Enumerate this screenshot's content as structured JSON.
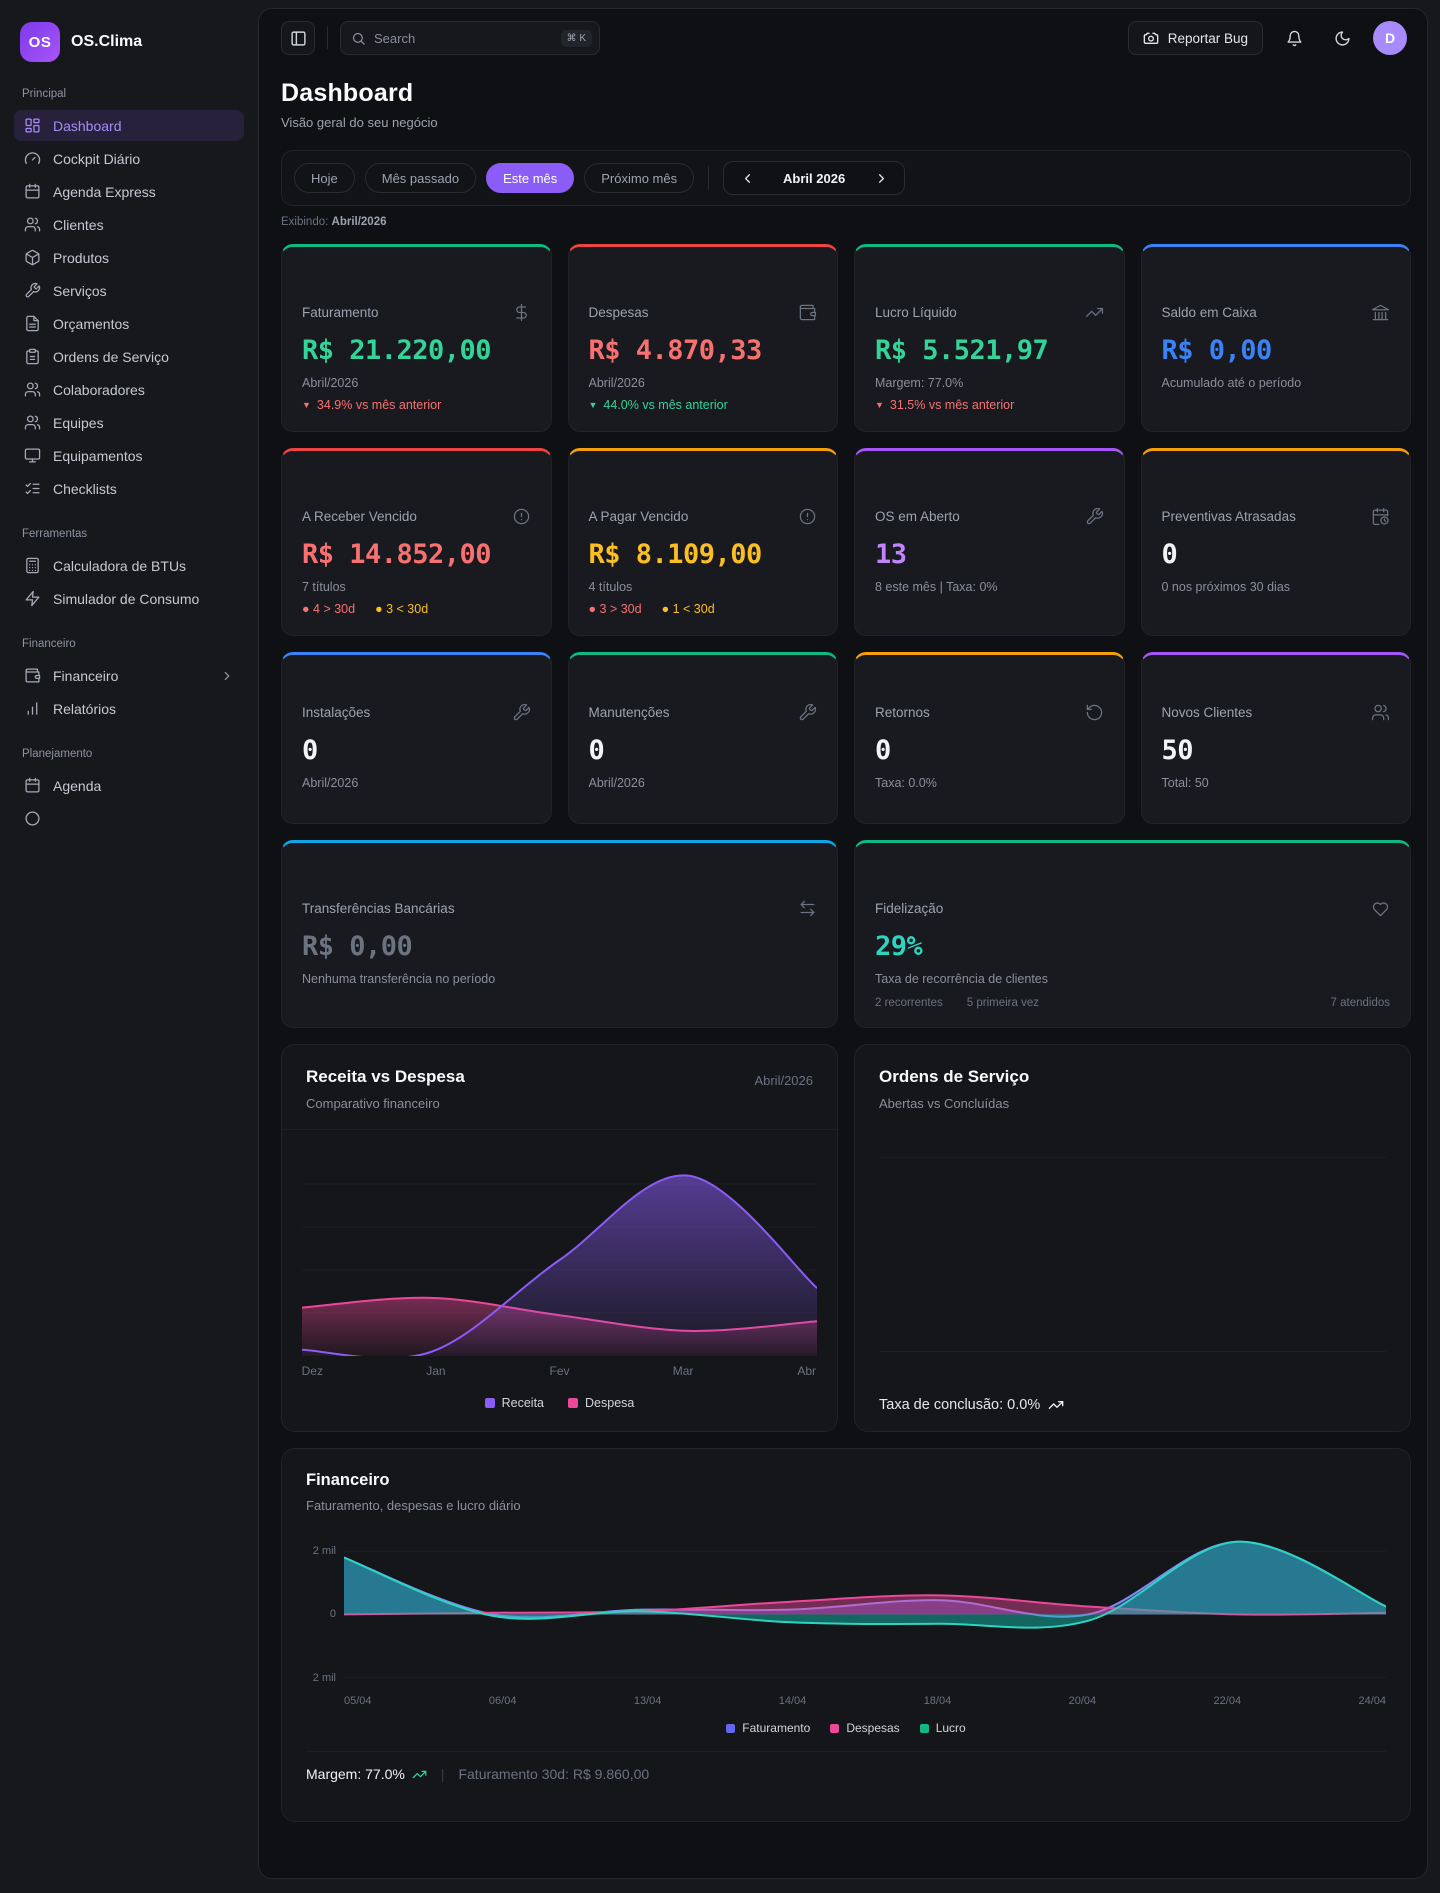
{
  "brand": {
    "logo_text": "OS",
    "name": "OS.Clima"
  },
  "topbar": {
    "search_placeholder": "Search",
    "search_shortcut": "⌘ K",
    "report_bug_label": "Reportar Bug",
    "avatar_initial": "D"
  },
  "header": {
    "title": "Dashboard",
    "subtitle": "Visão geral do seu negócio",
    "filters": [
      {
        "label": "Hoje",
        "active": false
      },
      {
        "label": "Mês passado",
        "active": false
      },
      {
        "label": "Este mês",
        "active": true
      },
      {
        "label": "Próximo mês",
        "active": false
      }
    ],
    "month_nav_label": "Abril 2026",
    "showing_label": "Exibindo:",
    "showing_value": "Abril/2026"
  },
  "sidebar": {
    "sections": [
      {
        "label": "Principal",
        "items": [
          {
            "label": "Dashboard",
            "icon": "layout-dashboard-icon",
            "active": true
          },
          {
            "label": "Cockpit Diário",
            "icon": "gauge-icon"
          },
          {
            "label": "Agenda Express",
            "icon": "calendar-icon"
          },
          {
            "label": "Clientes",
            "icon": "users-icon"
          },
          {
            "label": "Produtos",
            "icon": "package-icon"
          },
          {
            "label": "Serviços",
            "icon": "wrench-icon"
          },
          {
            "label": "Orçamentos",
            "icon": "file-text-icon"
          },
          {
            "label": "Ordens de Serviço",
            "icon": "clipboard-icon"
          },
          {
            "label": "Colaboradores",
            "icon": "users-icon"
          },
          {
            "label": "Equipes",
            "icon": "users-icon"
          },
          {
            "label": "Equipamentos",
            "icon": "monitor-icon"
          },
          {
            "label": "Checklists",
            "icon": "list-checks-icon"
          }
        ]
      },
      {
        "label": "Ferramentas",
        "items": [
          {
            "label": "Calculadora de BTUs",
            "icon": "calculator-icon"
          },
          {
            "label": "Simulador de Consumo",
            "icon": "zap-icon"
          }
        ]
      },
      {
        "label": "Financeiro",
        "items": [
          {
            "label": "Financeiro",
            "icon": "wallet-icon",
            "chevron": true
          },
          {
            "label": "Relatórios",
            "icon": "bar-chart-icon"
          }
        ]
      },
      {
        "label": "Planejamento",
        "items": [
          {
            "label": "Agenda",
            "icon": "calendar-icon"
          },
          {
            "label": "",
            "icon": "circle-icon",
            "clipped": true
          }
        ]
      }
    ]
  },
  "kpis": [
    {
      "title": "Faturamento",
      "icon": "dollar-icon",
      "accent": "#10b981",
      "value": "R$ 21.220,00",
      "value_color": "#34d399",
      "sub": "Abril/2026",
      "delta": {
        "text": "34.9% vs mês anterior",
        "color": "#f87171"
      }
    },
    {
      "title": "Despesas",
      "icon": "wallet-icon",
      "accent": "#ef4444",
      "value": "R$ 4.870,33",
      "value_color": "#f87171",
      "sub": "Abril/2026",
      "delta": {
        "text": "44.0% vs mês anterior",
        "color": "#34d399"
      }
    },
    {
      "title": "Lucro Líquido",
      "icon": "trending-up-icon",
      "accent": "#10b981",
      "value": "R$ 5.521,97",
      "value_color": "#34d399",
      "sub": "Margem: 77.0%",
      "delta": {
        "text": "31.5% vs mês anterior",
        "color": "#f87171"
      }
    },
    {
      "title": "Saldo em Caixa",
      "icon": "landmark-icon",
      "accent": "#3b82f6",
      "value": "R$ 0,00",
      "value_color": "#3b82f6",
      "sub": "Acumulado até o período"
    },
    {
      "title": "A Receber Vencido",
      "icon": "alert-circle-icon",
      "accent": "#ef4444",
      "value": "R$ 14.852,00",
      "value_color": "#f87171",
      "sub": "7 títulos",
      "dots": [
        {
          "text": "4 > 30d",
          "color": "#f87171"
        },
        {
          "text": "3 < 30d",
          "color": "#fbbf24"
        }
      ]
    },
    {
      "title": "A Pagar Vencido",
      "icon": "alert-circle-icon",
      "accent": "#f59e0b",
      "value": "R$ 8.109,00",
      "value_color": "#fbbf24",
      "sub": "4 títulos",
      "dots": [
        {
          "text": "3 > 30d",
          "color": "#f87171"
        },
        {
          "text": "1 < 30d",
          "color": "#fbbf24"
        }
      ]
    },
    {
      "title": "OS em Aberto",
      "icon": "wrench-icon",
      "accent": "#a855f7",
      "value": "13",
      "value_color": "#c084fc",
      "sub": "8 este mês | Taxa: 0%"
    },
    {
      "title": "Preventivas Atrasadas",
      "icon": "calendar-clock-icon",
      "accent": "#f59e0b",
      "value": "0",
      "value_color": "#f3f4f6",
      "sub": "0 nos próximos 30 dias"
    },
    {
      "title": "Instalações",
      "icon": "wrench-icon",
      "accent": "#3b82f6",
      "value": "0",
      "value_color": "#f3f4f6",
      "sub": "Abril/2026",
      "small": true
    },
    {
      "title": "Manutenções",
      "icon": "wrench-icon",
      "accent": "#10b981",
      "value": "0",
      "value_color": "#f3f4f6",
      "sub": "Abril/2026",
      "small": true
    },
    {
      "title": "Retornos",
      "icon": "rotate-ccw-icon",
      "accent": "#f59e0b",
      "value": "0",
      "value_color": "#f3f4f6",
      "sub": "Taxa: 0.0%",
      "small": true
    },
    {
      "title": "Novos Clientes",
      "icon": "users-icon",
      "accent": "#a855f7",
      "value": "50",
      "value_color": "#f3f4f6",
      "sub": "Total: 50",
      "small": true
    }
  ],
  "wide_kpis": [
    {
      "title": "Transferências Bancárias",
      "icon": "transfer-icon",
      "accent": "#0ea5e9",
      "value": "R$ 0,00",
      "value_color": "#6b7280",
      "sub": "Nenhuma transferência no período"
    },
    {
      "title": "Fidelização",
      "icon": "heart-icon",
      "accent": "#10b981",
      "value": "29%",
      "value_color": "#2dd4bf",
      "sub": "Taxa de recorrência de clientes",
      "foot": {
        "left": [
          "2 recorrentes",
          "5 primeira vez"
        ],
        "right": "7 atendidos"
      }
    }
  ],
  "chart_data": [
    {
      "id": "receita-vs-despesa",
      "type": "area",
      "title": "Receita vs Despesa",
      "subtitle": "Comparativo financeiro",
      "badge": "Abril/2026",
      "categories": [
        "Dez",
        "Jan",
        "Fev",
        "Mar",
        "Abr"
      ],
      "series": [
        {
          "name": "Receita",
          "color": "#8b5cf6",
          "values": [
            400,
            0,
            17000,
            32600,
            11800
          ]
        },
        {
          "name": "Despesa",
          "color": "#ec4899",
          "values": [
            8200,
            10000,
            6800,
            3900,
            5700
          ]
        }
      ],
      "ylim": [
        0,
        34000
      ],
      "grid": true,
      "legend_position": "bottom",
      "values_estimated": true
    },
    {
      "id": "ordens-de-servico",
      "type": "line",
      "title": "Ordens de Serviço",
      "subtitle": "Abertas vs Concluídas",
      "series": [],
      "footer": "Taxa de conclusão: 0.0%"
    },
    {
      "id": "financeiro-diario",
      "type": "area",
      "title": "Financeiro",
      "subtitle": "Faturamento, despesas e lucro diário",
      "x": [
        "05/04",
        "06/04",
        "13/04",
        "14/04",
        "18/04",
        "20/04",
        "22/04",
        "24/04"
      ],
      "series": [
        {
          "name": "Faturamento",
          "color": "#6366f1",
          "values": [
            1800,
            0,
            150,
            150,
            450,
            0,
            2300,
            250
          ]
        },
        {
          "name": "Despesas",
          "color": "#ec4899",
          "values": [
            0,
            50,
            100,
            400,
            600,
            250,
            0,
            50
          ]
        },
        {
          "name": "Lucro",
          "color": "#10b981",
          "values": [
            1800,
            -50,
            100,
            -250,
            -300,
            -200,
            2300,
            250
          ]
        }
      ],
      "ylabels": [
        "2 mil",
        "0",
        "2 mil"
      ],
      "ylim": [
        -2300,
        2450
      ],
      "footer": {
        "margem": "Margem: 77.0%",
        "sep": "|",
        "fat30d": "Faturamento 30d: R$ 9.860,00"
      },
      "values_estimated": true
    }
  ]
}
